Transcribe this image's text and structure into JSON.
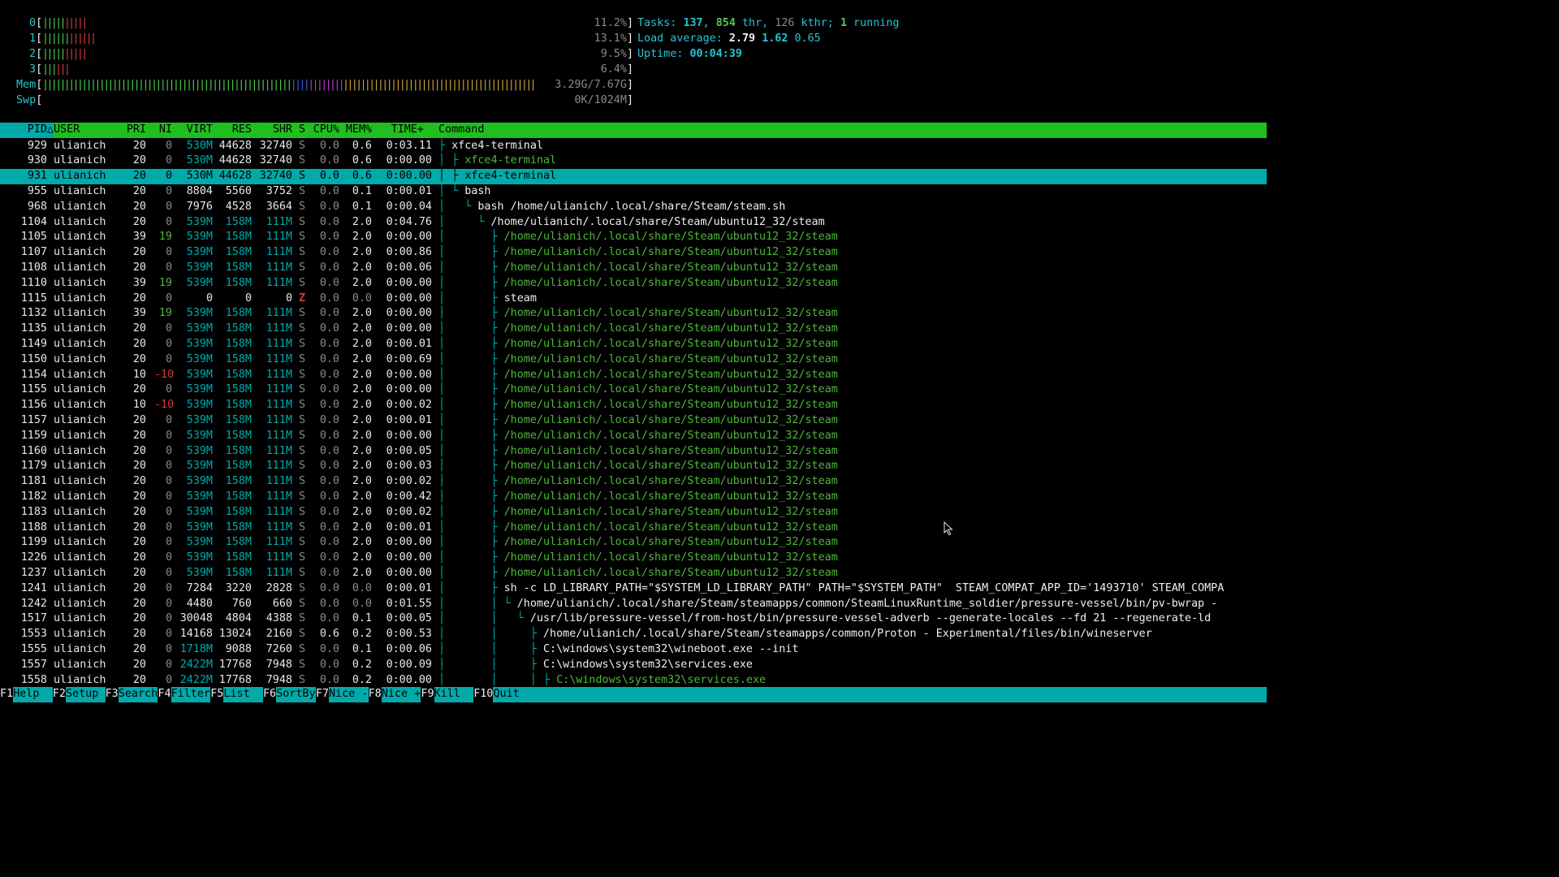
{
  "meters": [
    {
      "label": "0[",
      "segments": [
        [
          "green",
          "|||||"
        ],
        [
          "red",
          "|||||"
        ]
      ],
      "value": "11.2%]"
    },
    {
      "label": "1[",
      "segments": [
        [
          "green",
          "||||||"
        ],
        [
          "red",
          "||||||"
        ]
      ],
      "value": "13.1%]"
    },
    {
      "label": "2[",
      "segments": [
        [
          "green",
          "|||||"
        ],
        [
          "red",
          "|||||"
        ]
      ],
      "value": "9.5%]"
    },
    {
      "label": "3[",
      "segments": [
        [
          "green",
          "|||"
        ],
        [
          "red",
          "|||"
        ]
      ],
      "value": "6.4%]"
    },
    {
      "label": "Mem[",
      "segments": [
        [
          "green",
          "|||||||||||||||||||||||||||||||||||||||||||||||||||||||||"
        ],
        [
          "blue",
          "||||"
        ],
        [
          "mag",
          "||||||||"
        ],
        [
          "yel",
          "||||||||||||||||||||||||||||||||||||||||||||"
        ]
      ],
      "value": "3.29G/7.67G]"
    },
    {
      "label": "Swp[",
      "segments": [],
      "value": "0K/1024M]"
    }
  ],
  "summary": {
    "tasks_label": "Tasks: ",
    "tasks": "137",
    "thr_sep": ", ",
    "thr": "854",
    "thr_label": " thr, ",
    "kthr": "126",
    "kthr_label": " kthr; ",
    "running": "1",
    "running_label": " running",
    "load_label": "Load average: ",
    "load1": "2.79",
    "load5": "1.62",
    "load15": "0.65",
    "uptime_label": "Uptime: ",
    "uptime": "00:04:39"
  },
  "header": {
    "pid": "PID△",
    "user": "USER",
    "pri": "PRI",
    "ni": "NI",
    "virt": "VIRT",
    "res": "RES",
    "shr": "SHR",
    "s": "S",
    "cpu": "CPU%",
    "mem": "MEM%",
    "time": "TIME+",
    "cmd": "Command"
  },
  "processes": [
    {
      "pid": "929",
      "user": "ulianich",
      "pri": "20",
      "ni": "0",
      "virt": "530M",
      "res": "44628",
      "shr": "32740",
      "s": "S",
      "cpu": "0.0",
      "mem": "0.6",
      "time": "0:03.11",
      "tree": "├ ",
      "cmd": "xfce4-terminal",
      "thread": false,
      "sel": false
    },
    {
      "pid": "930",
      "user": "ulianich",
      "pri": "20",
      "ni": "0",
      "virt": "530M",
      "res": "44628",
      "shr": "32740",
      "s": "S",
      "cpu": "0.0",
      "mem": "0.6",
      "time": "0:00.00",
      "tree": "│ ├ ",
      "cmd": "xfce4-terminal",
      "thread": true,
      "sel": false
    },
    {
      "pid": "931",
      "user": "ulianich",
      "pri": "20",
      "ni": "0",
      "virt": "530M",
      "res": "44628",
      "shr": "32740",
      "s": "S",
      "cpu": "0.0",
      "mem": "0.6",
      "time": "0:00.00",
      "tree": "│ ├ ",
      "cmd": "xfce4-terminal",
      "thread": true,
      "sel": true
    },
    {
      "pid": "955",
      "user": "ulianich",
      "pri": "20",
      "ni": "0",
      "virt": "8804",
      "res": "5560",
      "shr": "3752",
      "s": "S",
      "cpu": "0.0",
      "mem": "0.1",
      "time": "0:00.01",
      "tree": "│ └ ",
      "cmd": "bash",
      "thread": false,
      "sel": false
    },
    {
      "pid": "968",
      "user": "ulianich",
      "pri": "20",
      "ni": "0",
      "virt": "7976",
      "res": "4528",
      "shr": "3664",
      "s": "S",
      "cpu": "0.0",
      "mem": "0.1",
      "time": "0:00.04",
      "tree": "│   └ ",
      "cmd": "bash /home/ulianich/.local/share/Steam/steam.sh",
      "thread": false,
      "sel": false
    },
    {
      "pid": "1104",
      "user": "ulianich",
      "pri": "20",
      "ni": "0",
      "virt": "539M",
      "res": "158M",
      "shr": "111M",
      "s": "S",
      "cpu": "0.0",
      "mem": "2.0",
      "time": "0:04.76",
      "tree": "│     └ ",
      "cmd": "/home/ulianich/.local/share/Steam/ubuntu12_32/steam",
      "thread": false,
      "sel": false
    },
    {
      "pid": "1105",
      "user": "ulianich",
      "pri": "39",
      "ni": "19",
      "virt": "539M",
      "res": "158M",
      "shr": "111M",
      "s": "S",
      "cpu": "0.0",
      "mem": "2.0",
      "time": "0:00.00",
      "tree": "│       ├ ",
      "cmd": "/home/ulianich/.local/share/Steam/ubuntu12_32/steam",
      "thread": true,
      "sel": false
    },
    {
      "pid": "1107",
      "user": "ulianich",
      "pri": "20",
      "ni": "0",
      "virt": "539M",
      "res": "158M",
      "shr": "111M",
      "s": "S",
      "cpu": "0.0",
      "mem": "2.0",
      "time": "0:00.86",
      "tree": "│       ├ ",
      "cmd": "/home/ulianich/.local/share/Steam/ubuntu12_32/steam",
      "thread": true,
      "sel": false
    },
    {
      "pid": "1108",
      "user": "ulianich",
      "pri": "20",
      "ni": "0",
      "virt": "539M",
      "res": "158M",
      "shr": "111M",
      "s": "S",
      "cpu": "0.0",
      "mem": "2.0",
      "time": "0:00.06",
      "tree": "│       ├ ",
      "cmd": "/home/ulianich/.local/share/Steam/ubuntu12_32/steam",
      "thread": true,
      "sel": false
    },
    {
      "pid": "1110",
      "user": "ulianich",
      "pri": "39",
      "ni": "19",
      "virt": "539M",
      "res": "158M",
      "shr": "111M",
      "s": "S",
      "cpu": "0.0",
      "mem": "2.0",
      "time": "0:00.00",
      "tree": "│       ├ ",
      "cmd": "/home/ulianich/.local/share/Steam/ubuntu12_32/steam",
      "thread": true,
      "sel": false
    },
    {
      "pid": "1115",
      "user": "ulianich",
      "pri": "20",
      "ni": "0",
      "virt": "0",
      "res": "0",
      "shr": "0",
      "s": "Z",
      "cpu": "0.0",
      "mem": "0.0",
      "time": "0:00.00",
      "tree": "│       ├ ",
      "cmd": "steam",
      "thread": false,
      "sel": false
    },
    {
      "pid": "1132",
      "user": "ulianich",
      "pri": "39",
      "ni": "19",
      "virt": "539M",
      "res": "158M",
      "shr": "111M",
      "s": "S",
      "cpu": "0.0",
      "mem": "2.0",
      "time": "0:00.00",
      "tree": "│       ├ ",
      "cmd": "/home/ulianich/.local/share/Steam/ubuntu12_32/steam",
      "thread": true,
      "sel": false
    },
    {
      "pid": "1135",
      "user": "ulianich",
      "pri": "20",
      "ni": "0",
      "virt": "539M",
      "res": "158M",
      "shr": "111M",
      "s": "S",
      "cpu": "0.0",
      "mem": "2.0",
      "time": "0:00.00",
      "tree": "│       ├ ",
      "cmd": "/home/ulianich/.local/share/Steam/ubuntu12_32/steam",
      "thread": true,
      "sel": false
    },
    {
      "pid": "1149",
      "user": "ulianich",
      "pri": "20",
      "ni": "0",
      "virt": "539M",
      "res": "158M",
      "shr": "111M",
      "s": "S",
      "cpu": "0.0",
      "mem": "2.0",
      "time": "0:00.01",
      "tree": "│       ├ ",
      "cmd": "/home/ulianich/.local/share/Steam/ubuntu12_32/steam",
      "thread": true,
      "sel": false
    },
    {
      "pid": "1150",
      "user": "ulianich",
      "pri": "20",
      "ni": "0",
      "virt": "539M",
      "res": "158M",
      "shr": "111M",
      "s": "S",
      "cpu": "0.0",
      "mem": "2.0",
      "time": "0:00.69",
      "tree": "│       ├ ",
      "cmd": "/home/ulianich/.local/share/Steam/ubuntu12_32/steam",
      "thread": true,
      "sel": false
    },
    {
      "pid": "1154",
      "user": "ulianich",
      "pri": "10",
      "ni": "-10",
      "virt": "539M",
      "res": "158M",
      "shr": "111M",
      "s": "S",
      "cpu": "0.0",
      "mem": "2.0",
      "time": "0:00.00",
      "tree": "│       ├ ",
      "cmd": "/home/ulianich/.local/share/Steam/ubuntu12_32/steam",
      "thread": true,
      "sel": false
    },
    {
      "pid": "1155",
      "user": "ulianich",
      "pri": "20",
      "ni": "0",
      "virt": "539M",
      "res": "158M",
      "shr": "111M",
      "s": "S",
      "cpu": "0.0",
      "mem": "2.0",
      "time": "0:00.00",
      "tree": "│       ├ ",
      "cmd": "/home/ulianich/.local/share/Steam/ubuntu12_32/steam",
      "thread": true,
      "sel": false
    },
    {
      "pid": "1156",
      "user": "ulianich",
      "pri": "10",
      "ni": "-10",
      "virt": "539M",
      "res": "158M",
      "shr": "111M",
      "s": "S",
      "cpu": "0.0",
      "mem": "2.0",
      "time": "0:00.02",
      "tree": "│       ├ ",
      "cmd": "/home/ulianich/.local/share/Steam/ubuntu12_32/steam",
      "thread": true,
      "sel": false
    },
    {
      "pid": "1157",
      "user": "ulianich",
      "pri": "20",
      "ni": "0",
      "virt": "539M",
      "res": "158M",
      "shr": "111M",
      "s": "S",
      "cpu": "0.0",
      "mem": "2.0",
      "time": "0:00.01",
      "tree": "│       ├ ",
      "cmd": "/home/ulianich/.local/share/Steam/ubuntu12_32/steam",
      "thread": true,
      "sel": false
    },
    {
      "pid": "1159",
      "user": "ulianich",
      "pri": "20",
      "ni": "0",
      "virt": "539M",
      "res": "158M",
      "shr": "111M",
      "s": "S",
      "cpu": "0.0",
      "mem": "2.0",
      "time": "0:00.00",
      "tree": "│       ├ ",
      "cmd": "/home/ulianich/.local/share/Steam/ubuntu12_32/steam",
      "thread": true,
      "sel": false
    },
    {
      "pid": "1160",
      "user": "ulianich",
      "pri": "20",
      "ni": "0",
      "virt": "539M",
      "res": "158M",
      "shr": "111M",
      "s": "S",
      "cpu": "0.0",
      "mem": "2.0",
      "time": "0:00.05",
      "tree": "│       ├ ",
      "cmd": "/home/ulianich/.local/share/Steam/ubuntu12_32/steam",
      "thread": true,
      "sel": false
    },
    {
      "pid": "1179",
      "user": "ulianich",
      "pri": "20",
      "ni": "0",
      "virt": "539M",
      "res": "158M",
      "shr": "111M",
      "s": "S",
      "cpu": "0.0",
      "mem": "2.0",
      "time": "0:00.03",
      "tree": "│       ├ ",
      "cmd": "/home/ulianich/.local/share/Steam/ubuntu12_32/steam",
      "thread": true,
      "sel": false
    },
    {
      "pid": "1181",
      "user": "ulianich",
      "pri": "20",
      "ni": "0",
      "virt": "539M",
      "res": "158M",
      "shr": "111M",
      "s": "S",
      "cpu": "0.0",
      "mem": "2.0",
      "time": "0:00.02",
      "tree": "│       ├ ",
      "cmd": "/home/ulianich/.local/share/Steam/ubuntu12_32/steam",
      "thread": true,
      "sel": false
    },
    {
      "pid": "1182",
      "user": "ulianich",
      "pri": "20",
      "ni": "0",
      "virt": "539M",
      "res": "158M",
      "shr": "111M",
      "s": "S",
      "cpu": "0.0",
      "mem": "2.0",
      "time": "0:00.42",
      "tree": "│       ├ ",
      "cmd": "/home/ulianich/.local/share/Steam/ubuntu12_32/steam",
      "thread": true,
      "sel": false
    },
    {
      "pid": "1183",
      "user": "ulianich",
      "pri": "20",
      "ni": "0",
      "virt": "539M",
      "res": "158M",
      "shr": "111M",
      "s": "S",
      "cpu": "0.0",
      "mem": "2.0",
      "time": "0:00.02",
      "tree": "│       ├ ",
      "cmd": "/home/ulianich/.local/share/Steam/ubuntu12_32/steam",
      "thread": true,
      "sel": false
    },
    {
      "pid": "1188",
      "user": "ulianich",
      "pri": "20",
      "ni": "0",
      "virt": "539M",
      "res": "158M",
      "shr": "111M",
      "s": "S",
      "cpu": "0.0",
      "mem": "2.0",
      "time": "0:00.01",
      "tree": "│       ├ ",
      "cmd": "/home/ulianich/.local/share/Steam/ubuntu12_32/steam",
      "thread": true,
      "sel": false
    },
    {
      "pid": "1199",
      "user": "ulianich",
      "pri": "20",
      "ni": "0",
      "virt": "539M",
      "res": "158M",
      "shr": "111M",
      "s": "S",
      "cpu": "0.0",
      "mem": "2.0",
      "time": "0:00.00",
      "tree": "│       ├ ",
      "cmd": "/home/ulianich/.local/share/Steam/ubuntu12_32/steam",
      "thread": true,
      "sel": false
    },
    {
      "pid": "1226",
      "user": "ulianich",
      "pri": "20",
      "ni": "0",
      "virt": "539M",
      "res": "158M",
      "shr": "111M",
      "s": "S",
      "cpu": "0.0",
      "mem": "2.0",
      "time": "0:00.00",
      "tree": "│       ├ ",
      "cmd": "/home/ulianich/.local/share/Steam/ubuntu12_32/steam",
      "thread": true,
      "sel": false
    },
    {
      "pid": "1237",
      "user": "ulianich",
      "pri": "20",
      "ni": "0",
      "virt": "539M",
      "res": "158M",
      "shr": "111M",
      "s": "S",
      "cpu": "0.0",
      "mem": "2.0",
      "time": "0:00.00",
      "tree": "│       ├ ",
      "cmd": "/home/ulianich/.local/share/Steam/ubuntu12_32/steam",
      "thread": true,
      "sel": false
    },
    {
      "pid": "1241",
      "user": "ulianich",
      "pri": "20",
      "ni": "0",
      "virt": "7284",
      "res": "3220",
      "shr": "2828",
      "s": "S",
      "cpu": "0.0",
      "mem": "0.0",
      "time": "0:00.01",
      "tree": "│       ├ ",
      "cmd": "sh -c LD_LIBRARY_PATH=\"$SYSTEM_LD_LIBRARY_PATH\" PATH=\"$SYSTEM_PATH\"  STEAM_COMPAT_APP_ID='1493710' STEAM_COMPA",
      "thread": false,
      "sel": false
    },
    {
      "pid": "1242",
      "user": "ulianich",
      "pri": "20",
      "ni": "0",
      "virt": "4480",
      "res": "760",
      "shr": "660",
      "s": "S",
      "cpu": "0.0",
      "mem": "0.0",
      "time": "0:01.55",
      "tree": "│       │ └ ",
      "cmd": "/home/ulianich/.local/share/Steam/steamapps/common/SteamLinuxRuntime_soldier/pressure-vessel/bin/pv-bwrap -",
      "thread": false,
      "sel": false
    },
    {
      "pid": "1517",
      "user": "ulianich",
      "pri": "20",
      "ni": "0",
      "virt": "30048",
      "res": "4804",
      "shr": "4388",
      "s": "S",
      "cpu": "0.0",
      "mem": "0.1",
      "time": "0:00.05",
      "tree": "│       │   └ ",
      "cmd": "/usr/lib/pressure-vessel/from-host/bin/pressure-vessel-adverb --generate-locales --fd 21 --regenerate-ld",
      "thread": false,
      "sel": false
    },
    {
      "pid": "1553",
      "user": "ulianich",
      "pri": "20",
      "ni": "0",
      "virt": "14168",
      "res": "13024",
      "shr": "2160",
      "s": "S",
      "cpu": "0.6",
      "mem": "0.2",
      "time": "0:00.53",
      "tree": "│       │     ├ ",
      "cmd": "/home/ulianich/.local/share/Steam/steamapps/common/Proton - Experimental/files/bin/wineserver",
      "thread": false,
      "sel": false
    },
    {
      "pid": "1555",
      "user": "ulianich",
      "pri": "20",
      "ni": "0",
      "virt": "1718M",
      "res": "9088",
      "shr": "7260",
      "s": "S",
      "cpu": "0.0",
      "mem": "0.1",
      "time": "0:00.06",
      "tree": "│       │     ├ ",
      "cmd": "C:\\windows\\system32\\wineboot.exe --init",
      "thread": false,
      "sel": false
    },
    {
      "pid": "1557",
      "user": "ulianich",
      "pri": "20",
      "ni": "0",
      "virt": "2422M",
      "res": "17768",
      "shr": "7948",
      "s": "S",
      "cpu": "0.0",
      "mem": "0.2",
      "time": "0:00.09",
      "tree": "│       │     ├ ",
      "cmd": "C:\\windows\\system32\\services.exe",
      "thread": false,
      "sel": false
    },
    {
      "pid": "1558",
      "user": "ulianich",
      "pri": "20",
      "ni": "0",
      "virt": "2422M",
      "res": "17768",
      "shr": "7948",
      "s": "S",
      "cpu": "0.0",
      "mem": "0.2",
      "time": "0:00.00",
      "tree": "│       │     │ ├ ",
      "cmd": "C:\\windows\\system32\\services.exe",
      "thread": true,
      "sel": false
    }
  ],
  "fkeys": [
    {
      "key": "F1",
      "label": "Help  "
    },
    {
      "key": "F2",
      "label": "Setup "
    },
    {
      "key": "F3",
      "label": "Search"
    },
    {
      "key": "F4",
      "label": "Filter"
    },
    {
      "key": "F5",
      "label": "List  "
    },
    {
      "key": "F6",
      "label": "SortBy"
    },
    {
      "key": "F7",
      "label": "Nice -"
    },
    {
      "key": "F8",
      "label": "Nice +"
    },
    {
      "key": "F9",
      "label": "Kill  "
    },
    {
      "key": "F10",
      "label": "Quit  "
    }
  ],
  "colors": {
    "header_bg": "#1fbf1f",
    "selection_bg": "#00aaaa",
    "thread_fg": "#4fb83b",
    "zombie_fg": "#d63a3a"
  }
}
